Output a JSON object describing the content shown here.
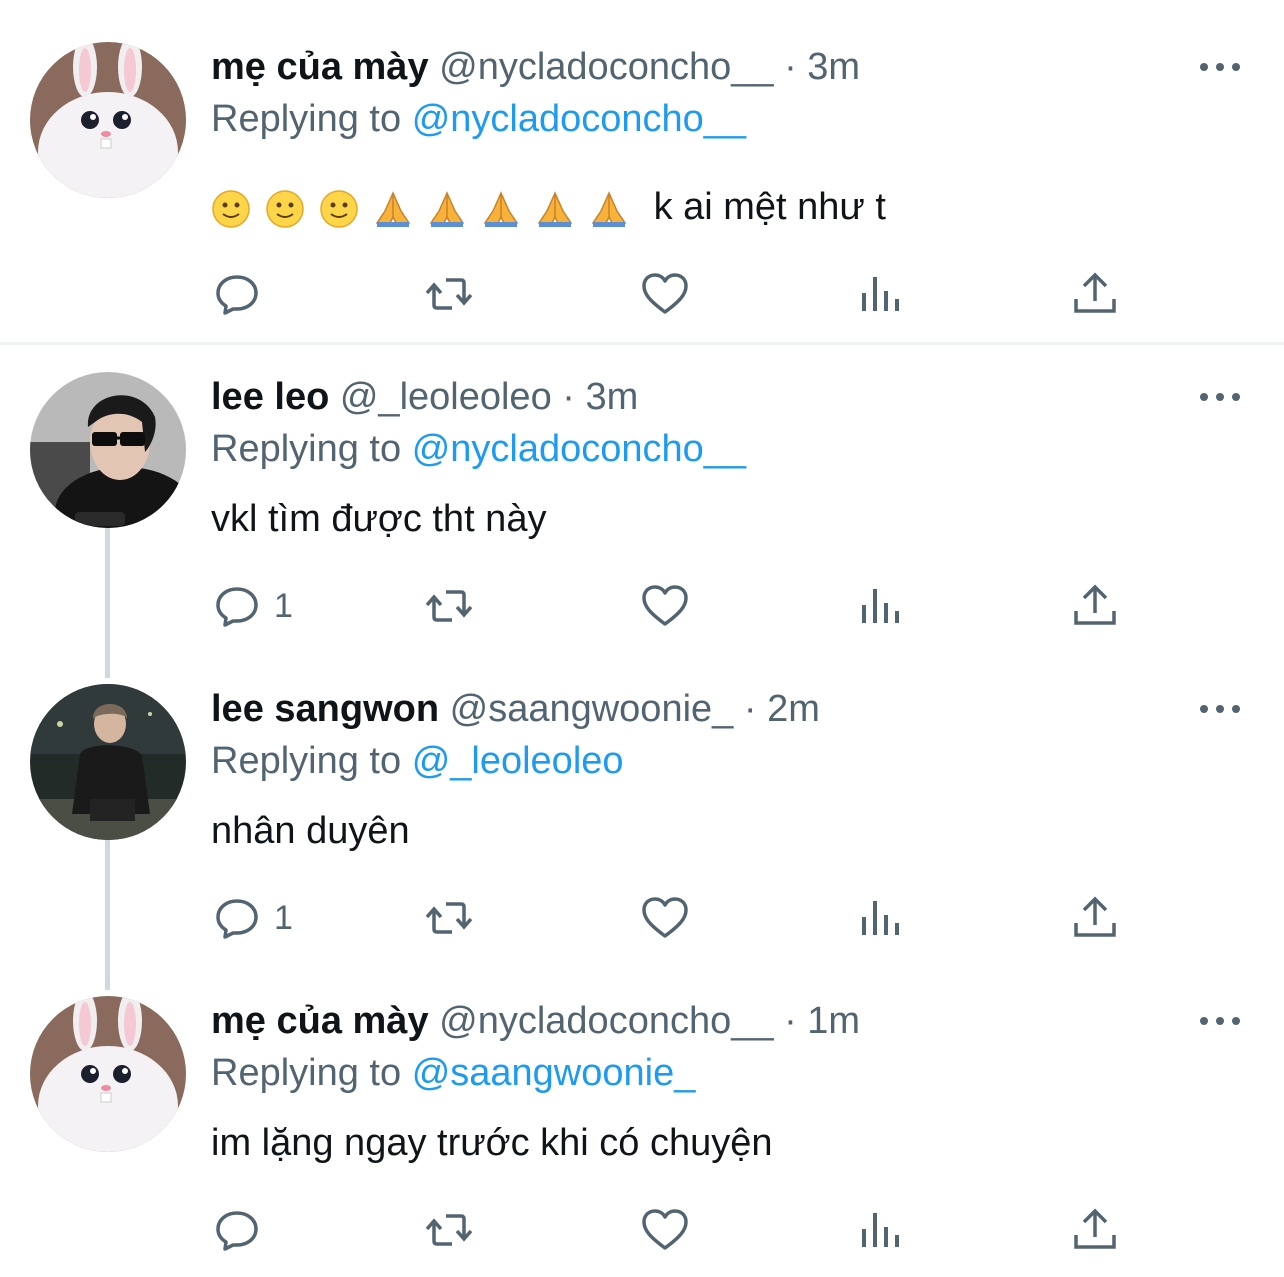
{
  "tweets": [
    {
      "name": "mẹ của mày",
      "handle": "@nycladoconcho__",
      "dot": "·",
      "time": "3m",
      "replying_label": "Replying to",
      "replying_to": "@nycladoconcho__",
      "text": "k ai mệt như t",
      "emoji_prefix": [
        "slightly-smiling-face",
        "slightly-smiling-face",
        "slightly-smiling-face",
        "folded-hands",
        "folded-hands",
        "folded-hands",
        "folded-hands",
        "folded-hands"
      ],
      "reply_count": ""
    },
    {
      "name": "lee leo",
      "handle": "@_leoleoleo",
      "dot": "·",
      "time": "3m",
      "replying_label": "Replying to",
      "replying_to": "@nycladoconcho__",
      "text": "vkl tìm được tht này",
      "reply_count": "1"
    },
    {
      "name": "lee sangwon",
      "handle": "@saangwoonie_",
      "dot": "·",
      "time": "2m",
      "replying_label": "Replying to",
      "replying_to": "@_leoleoleo",
      "text": "nhân duyên",
      "reply_count": "1"
    },
    {
      "name": "mẹ của mày",
      "handle": "@nycladoconcho__",
      "dot": "·",
      "time": "1m",
      "replying_label": "Replying to",
      "replying_to": "@saangwoonie_",
      "text": "im lặng ngay trước khi có chuyện",
      "reply_count": ""
    }
  ],
  "icons": {
    "reply": "reply-icon",
    "retweet": "retweet-icon",
    "like": "like-icon",
    "views": "views-icon",
    "share": "share-icon",
    "more": "more-icon"
  },
  "colors": {
    "name": "#0f1419",
    "secondary": "#536471",
    "mention": "#1d9bf0",
    "divider": "#eff3f4",
    "thread_line": "#cfd9de"
  }
}
